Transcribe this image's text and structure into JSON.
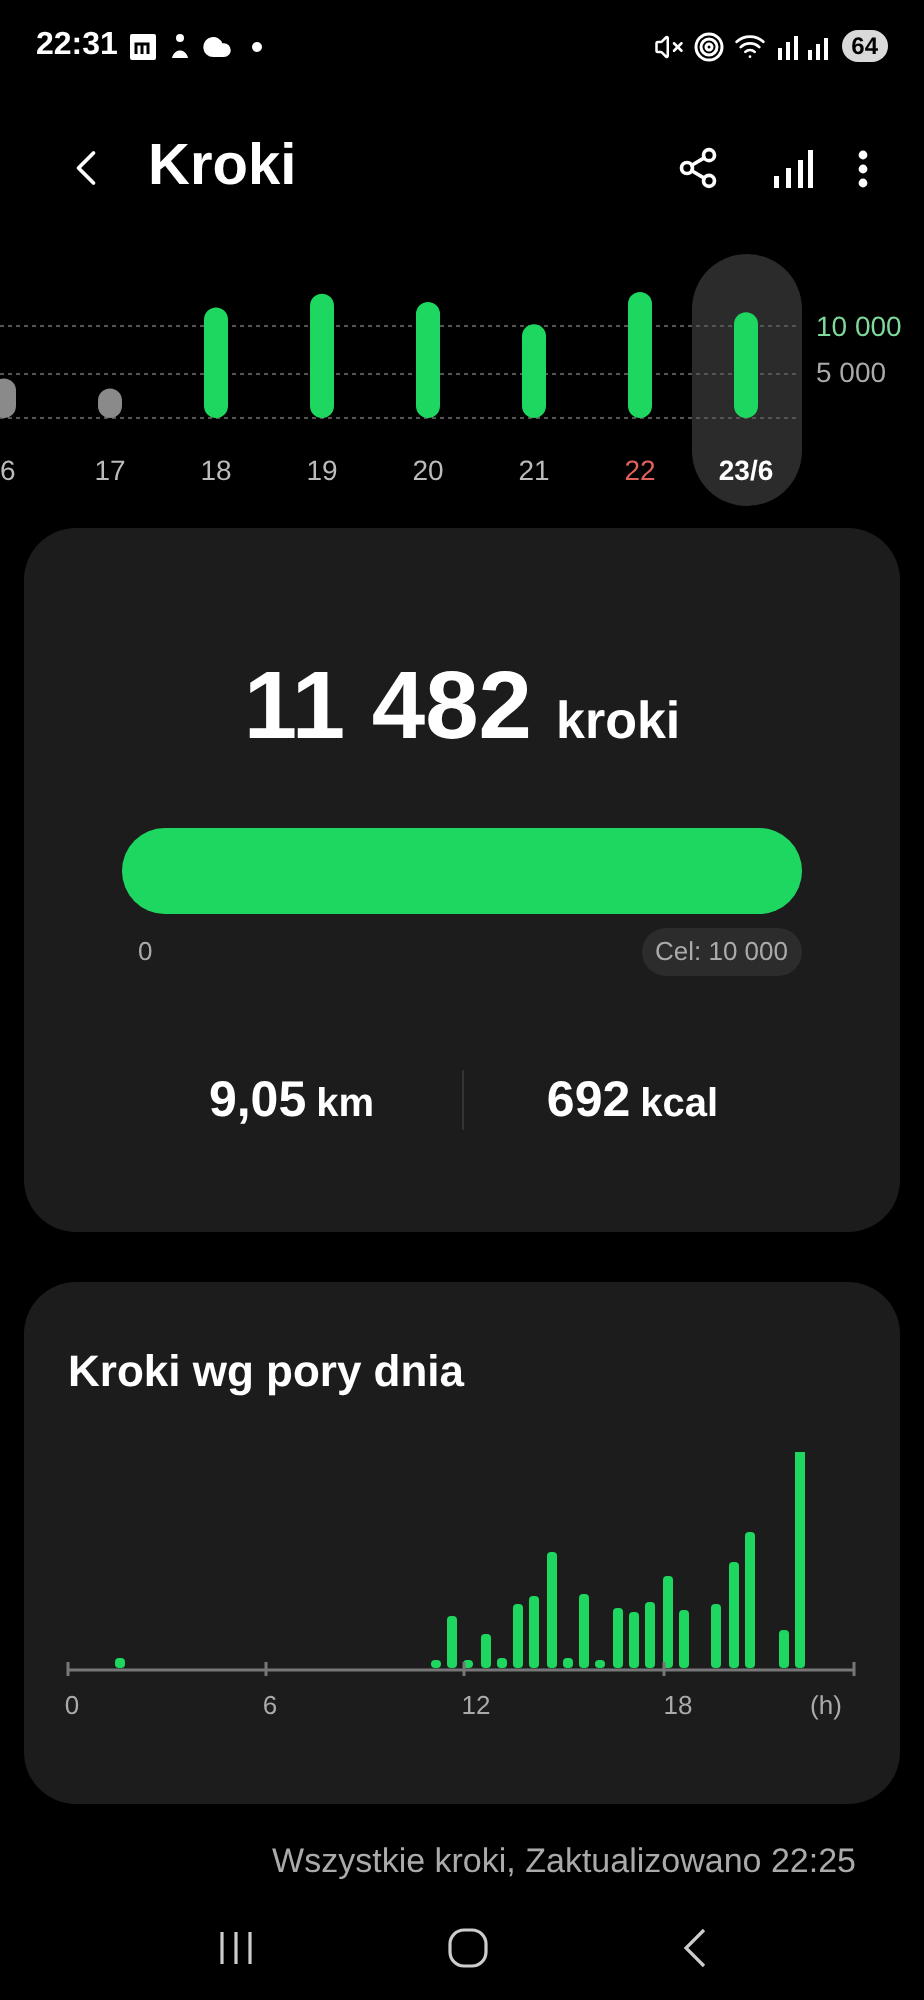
{
  "status_bar": {
    "time": "22:31",
    "battery": "64"
  },
  "header": {
    "title": "Kroki"
  },
  "daily": {
    "chart_data": {
      "type": "bar",
      "categories": [
        "6",
        "17",
        "18",
        "19",
        "20",
        "21",
        "22",
        "23/6"
      ],
      "series": [
        {
          "color": "#8a8a8a",
          "values": [
            4300,
            3200,
            null,
            null,
            null,
            null,
            null,
            null
          ]
        },
        {
          "color": "#1ed760",
          "values": [
            null,
            null,
            12000,
            13500,
            12600,
            10200,
            13700,
            11500
          ]
        }
      ],
      "ylim": [
        0,
        14000
      ],
      "yticks": [
        {
          "value": 10000,
          "label": "10 000"
        },
        {
          "value": 5000,
          "label": "5 000"
        }
      ]
    },
    "days": [
      {
        "selected": false,
        "holiday": false
      },
      {
        "selected": false,
        "holiday": false
      },
      {
        "selected": false,
        "holiday": false
      },
      {
        "selected": false,
        "holiday": false
      },
      {
        "selected": false,
        "holiday": false
      },
      {
        "selected": false,
        "holiday": false
      },
      {
        "selected": false,
        "holiday": true
      },
      {
        "selected": true,
        "holiday": false
      }
    ]
  },
  "summary": {
    "steps": "11 482",
    "unit": "kroki",
    "level": 1,
    "min_label": "0",
    "goal_label": "Cel: 10 000",
    "stats": [
      {
        "value": "9,05",
        "unit": "km"
      },
      {
        "value": "692",
        "unit": "kcal"
      }
    ]
  },
  "by_time": {
    "title": "Kroki wg pory dnia",
    "x_labels": [
      "0",
      "6",
      "12",
      "18",
      "(h)"
    ]
  },
  "footer": "Wszystkie kroki, Zaktualizowano 22:25"
}
